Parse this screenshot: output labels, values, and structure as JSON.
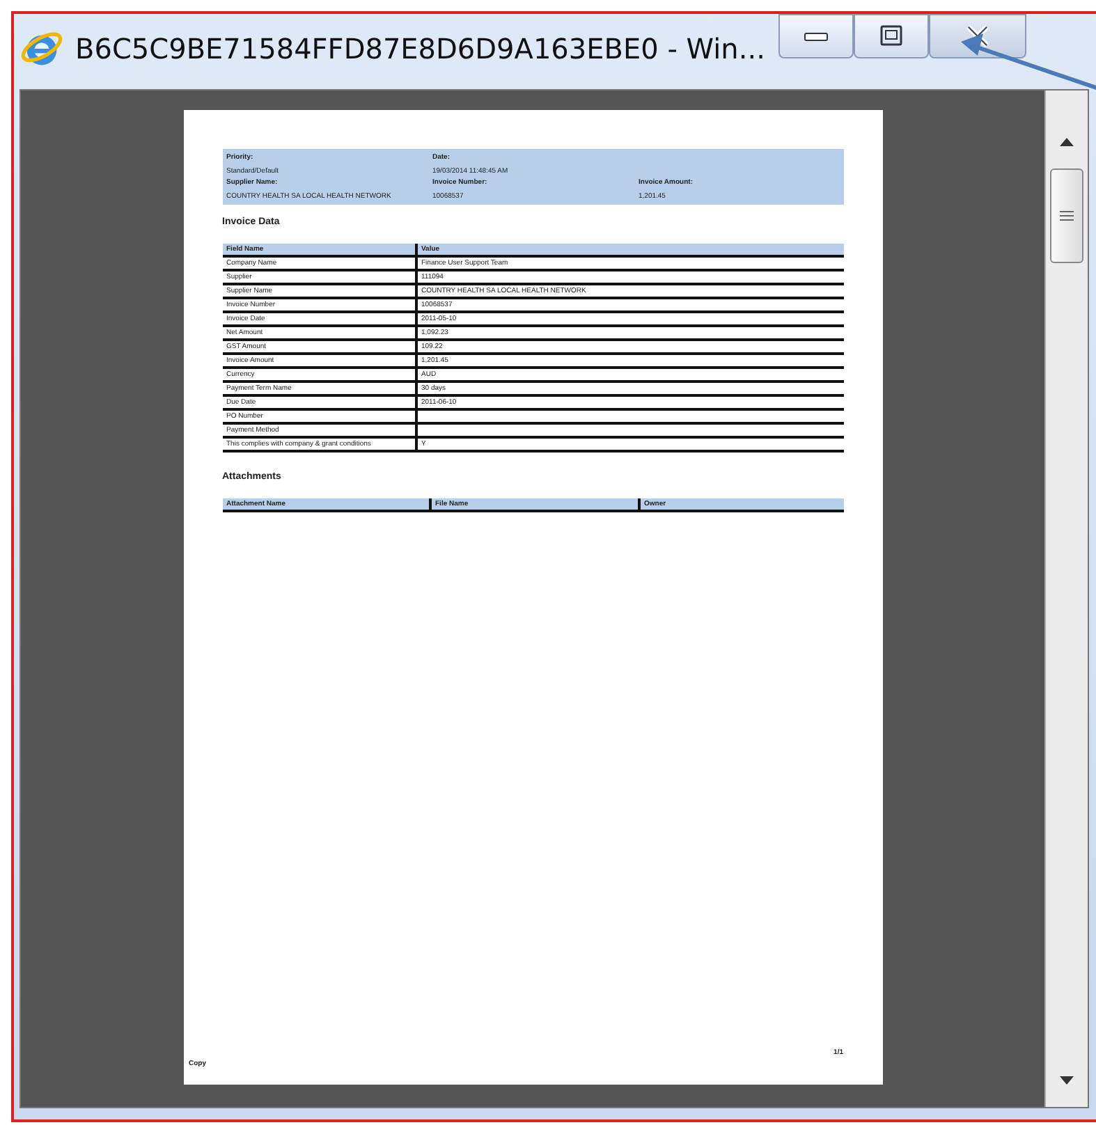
{
  "window": {
    "title": "B6C5C9BE71584FFD87E8D6D9A163EBE0 - Win..."
  },
  "summary": [
    {
      "label": "Priority:",
      "value": "Standard/Default"
    },
    {
      "label": "Date:",
      "value": "19/03/2014 11:48:45 AM"
    },
    {
      "label": "Supplier Name:",
      "value": "COUNTRY HEALTH SA LOCAL HEALTH NETWORK"
    },
    {
      "label": "Invoice Number:",
      "value": "10068537"
    },
    {
      "label": "Invoice Amount:",
      "value": "1,201.45"
    }
  ],
  "invoice_data": {
    "heading": "Invoice Data",
    "columns": [
      "Field Name",
      "Value"
    ],
    "rows": [
      [
        "Company Name",
        "Finance User Support Team"
      ],
      [
        "Supplier",
        "111094"
      ],
      [
        "Supplier Name",
        "COUNTRY HEALTH SA LOCAL HEALTH NETWORK"
      ],
      [
        "Invoice Number",
        "10068537"
      ],
      [
        "Invoice Date",
        "2011-05-10"
      ],
      [
        "Net Amount",
        "1,092.23"
      ],
      [
        "GST Amount",
        "109.22"
      ],
      [
        "Invoice Amount",
        "1,201.45"
      ],
      [
        "Currency",
        "AUD"
      ],
      [
        "Payment Term Name",
        "30 days"
      ],
      [
        "Due Date",
        "2011-06-10"
      ],
      [
        "PO Number"
      ],
      [
        "Payment Method"
      ],
      [
        "This complies with company & grant conditions",
        "Y"
      ]
    ]
  },
  "attachments": {
    "heading": "Attachments",
    "columns": [
      "Attachment Name",
      "File Name",
      "Owner"
    ]
  },
  "footer": {
    "left": "Copy",
    "right": "1/1"
  }
}
